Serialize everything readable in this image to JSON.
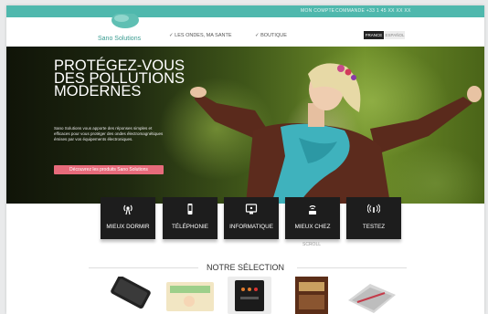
{
  "topbar": {
    "account": "MON COMPTE",
    "cart": "COMMANDE +33 1 45 XX XX XX"
  },
  "header": {
    "logo_text": "Sano Solutions",
    "nav": [
      "LES ONDES, MA SANTE",
      "BOUTIQUE"
    ],
    "lang": [
      "FRANCE",
      "ESPAÑOL"
    ]
  },
  "hero": {
    "title": "PROTÉGEZ-VOUS DES POLLUTIONS MODERNES",
    "text": "Sano Solutions vous apporte des réponses simples et efficaces pour vous protéger des ondes électromagnétiques émises par vos équipements électroniques.",
    "button": "Découvrez les produits Sano Solutions"
  },
  "categories": [
    {
      "label": "MIEUX DORMIR",
      "icon": "radio-waves-icon"
    },
    {
      "label": "TÉLÉPHONIE",
      "icon": "phone-icon"
    },
    {
      "label": "INFORMATIQUE",
      "icon": "monitor-icon"
    },
    {
      "label": "MIEUX CHEZ",
      "icon": "wifi-router-icon"
    },
    {
      "label": "TESTEZ",
      "icon": "signal-icon"
    }
  ],
  "scroll_hint": "SCROLL",
  "selection": {
    "title": "NOTRE SÉLECTION",
    "products": [
      "phone-case",
      "baby-pad",
      "tablet-meter",
      "book",
      "pouch"
    ]
  },
  "colors": {
    "accent": "#4fb8ad",
    "button": "#e76b7b",
    "tile": "#1d1d1d"
  }
}
